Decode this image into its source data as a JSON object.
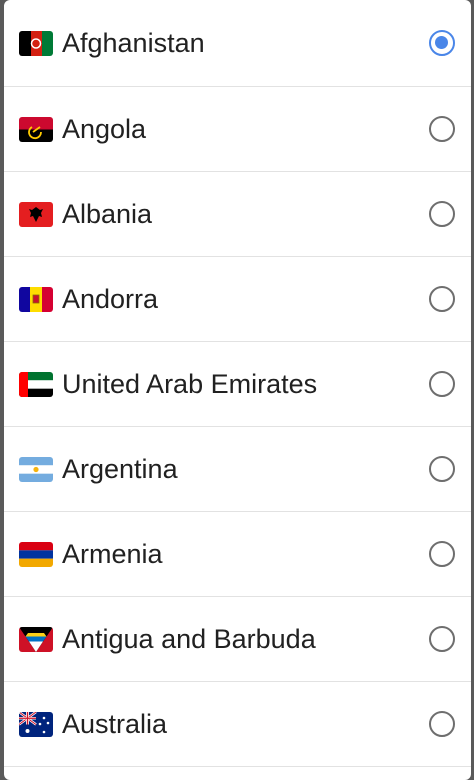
{
  "countries": [
    {
      "label": "Afghanistan",
      "flag_icon": "afghanistan-flag-icon",
      "selected": true
    },
    {
      "label": "Angola",
      "flag_icon": "angola-flag-icon",
      "selected": false
    },
    {
      "label": "Albania",
      "flag_icon": "albania-flag-icon",
      "selected": false
    },
    {
      "label": "Andorra",
      "flag_icon": "andorra-flag-icon",
      "selected": false
    },
    {
      "label": "United Arab Emirates",
      "flag_icon": "uae-flag-icon",
      "selected": false
    },
    {
      "label": "Argentina",
      "flag_icon": "argentina-flag-icon",
      "selected": false
    },
    {
      "label": "Armenia",
      "flag_icon": "armenia-flag-icon",
      "selected": false
    },
    {
      "label": "Antigua and Barbuda",
      "flag_icon": "antigua-barbuda-flag-icon",
      "selected": false
    },
    {
      "label": "Australia",
      "flag_icon": "australia-flag-icon",
      "selected": false
    }
  ],
  "colors": {
    "accent": "#4a86e8",
    "radio_unchecked": "#6e6e6e",
    "text": "#212121",
    "divider": "#e2e2e2"
  }
}
